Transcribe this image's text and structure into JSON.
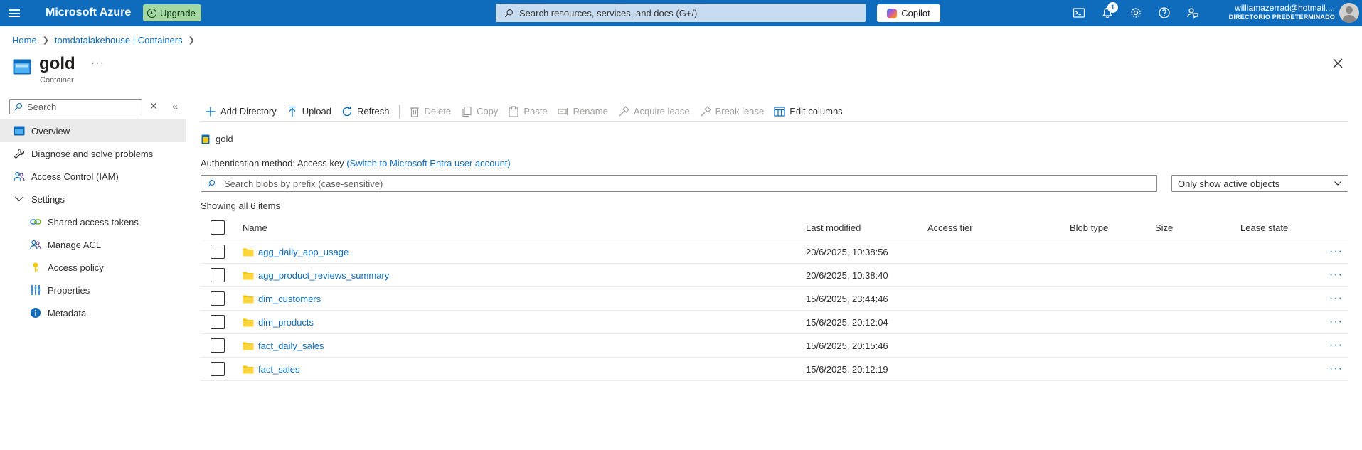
{
  "topbar": {
    "brand": "Microsoft Azure",
    "upgrade_label": "Upgrade",
    "search_placeholder": "Search resources, services, and docs (G+/)",
    "copilot_label": "Copilot",
    "notification_count": "1",
    "account_email": "williamazerrad@hotmail....",
    "account_directory": "DIRECTORIO PREDETERMINADO"
  },
  "breadcrumb": {
    "home": "Home",
    "parent": "tomdatalakehouse | Containers"
  },
  "page": {
    "title": "gold",
    "subtitle": "Container"
  },
  "nav": {
    "search_placeholder": "Search",
    "items": [
      {
        "label": "Overview",
        "icon": "container-icon",
        "active": true
      },
      {
        "label": "Diagnose and solve problems",
        "icon": "wrench-icon"
      },
      {
        "label": "Access Control (IAM)",
        "icon": "people-icon"
      },
      {
        "label": "Settings",
        "icon": "chevron-down-icon"
      },
      {
        "label": "Shared access tokens",
        "icon": "link-icon"
      },
      {
        "label": "Manage ACL",
        "icon": "people-icon"
      },
      {
        "label": "Access policy",
        "icon": "key-icon"
      },
      {
        "label": "Properties",
        "icon": "properties-icon"
      },
      {
        "label": "Metadata",
        "icon": "info-icon"
      }
    ]
  },
  "toolbar": {
    "add_directory": "Add Directory",
    "upload": "Upload",
    "refresh": "Refresh",
    "delete": "Delete",
    "copy": "Copy",
    "paste": "Paste",
    "rename": "Rename",
    "acquire_lease": "Acquire lease",
    "break_lease": "Break lease",
    "edit_columns": "Edit columns"
  },
  "location": "gold",
  "auth": {
    "label": "Authentication method:",
    "method": "Access key",
    "switch_link": "(Switch to Microsoft Entra user account)"
  },
  "blob_search_placeholder": "Search blobs by prefix (case-sensitive)",
  "filter_value": "Only show active objects",
  "item_count": "Showing all 6 items",
  "table": {
    "columns": {
      "name": "Name",
      "last_modified": "Last modified",
      "access_tier": "Access tier",
      "blob_type": "Blob type",
      "size": "Size",
      "lease_state": "Lease state"
    },
    "rows": [
      {
        "name": "agg_daily_app_usage",
        "modified": "20/6/2025, 10:38:56"
      },
      {
        "name": "agg_product_reviews_summary",
        "modified": "20/6/2025, 10:38:40"
      },
      {
        "name": "dim_customers",
        "modified": "15/6/2025, 23:44:46"
      },
      {
        "name": "dim_products",
        "modified": "15/6/2025, 20:12:04"
      },
      {
        "name": "fact_daily_sales",
        "modified": "15/6/2025, 20:15:46"
      },
      {
        "name": "fact_sales",
        "modified": "15/6/2025, 20:12:19"
      }
    ]
  },
  "colors": {
    "topbar": "#0f6cbd",
    "link": "#0f6cbd",
    "folder": "#f7c600",
    "upgrade_bg": "#a3d7a4"
  }
}
